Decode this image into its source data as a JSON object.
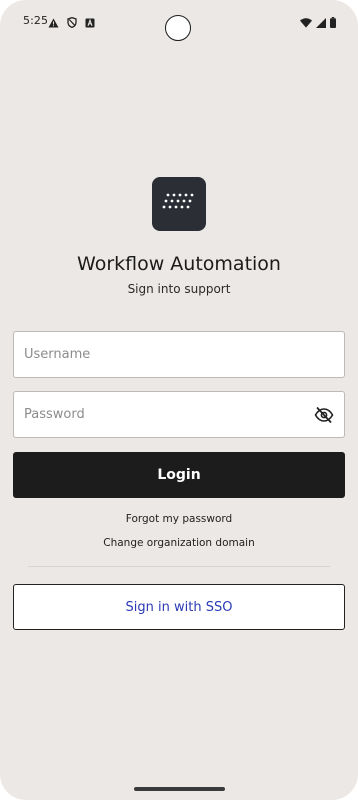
{
  "status_bar": {
    "time": "5:25",
    "left_icons": [
      "warning-icon",
      "shield-icon",
      "font-a-icon"
    ],
    "right_icons": [
      "wifi-icon",
      "signal-icon",
      "battery-icon"
    ]
  },
  "app": {
    "title": "Workflow Automation",
    "subtitle": "Sign into support",
    "logo_icon": "dots-logo-icon"
  },
  "form": {
    "username_placeholder": "Username",
    "username_value": "",
    "password_placeholder": "Password",
    "password_value": "",
    "password_toggle_icon": "eye-off-icon",
    "login_label": "Login",
    "forgot_password_label": "Forgot my password",
    "change_domain_label": "Change organization domain",
    "sso_label": "Sign in with SSO"
  },
  "colors": {
    "background": "#ece8e5",
    "primary_button": "#1c1c1c",
    "sso_text": "#2a3ab5",
    "logo_background": "#2b2e35"
  }
}
